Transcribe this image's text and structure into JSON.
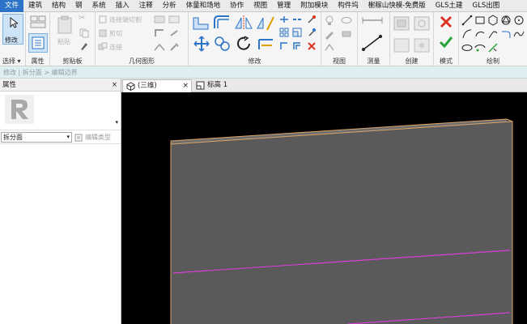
{
  "menu": [
    "文件",
    "建筑",
    "结构",
    "钢",
    "系统",
    "插入",
    "注释",
    "分析",
    "体量和场地",
    "协作",
    "视图",
    "管理",
    "附加模块",
    "构件坞",
    "榭稼山快模-免费版",
    "GLS土建",
    "GLS出图"
  ],
  "ribbon": {
    "select": {
      "modify_label": "修改",
      "label": "选择",
      "dropdown": "▾"
    },
    "properties": {
      "label": "属性"
    },
    "clipboard": {
      "paste_label": "粘贴",
      "label": "剪贴板"
    },
    "geometry": {
      "items": [
        "连接端切割",
        "剪切",
        "连接"
      ],
      "label": "几何图形"
    },
    "modify": {
      "label": "修改"
    },
    "view": {
      "label": "视图"
    },
    "measure": {
      "label": "测量"
    },
    "create": {
      "label": "创建"
    },
    "mode": {
      "label": "模式"
    },
    "draw": {
      "label": "绘制"
    }
  },
  "pathbar": {
    "text": "修改 | 拆分面 > 编辑边界"
  },
  "properties_panel": {
    "title": "属性",
    "close": "×",
    "type_selector": "拆分面",
    "edit_type": "编辑类型"
  },
  "tabs": [
    {
      "label": "(三维)",
      "close": "×"
    },
    {
      "label": "标高 1",
      "close": ""
    }
  ],
  "colors": {
    "accent": "#2b74c8",
    "sketch_line": "#d63fd6",
    "face": "#5a5a5a",
    "edge": "#d9a56a"
  }
}
